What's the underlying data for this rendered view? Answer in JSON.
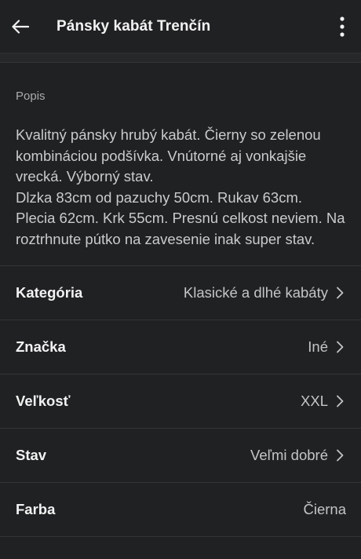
{
  "header": {
    "title": "Pánsky kabát Trenčín",
    "back_icon": "arrow-left-icon",
    "more_icon": "more-vertical-icon"
  },
  "description": {
    "label": "Popis",
    "text": "Kvalitný pánsky hrubý kabát. Čierny so zelenou kombináciou podšívka. Vnútorné aj vonkajšie vrecká. Výborný stav.\nDlzka 83cm od pazuchy 50cm. Rukav 63cm. Plecia 62cm. Krk 55cm. Presnú celkost neviem. Na roztrhnute pútko na zavesenie inak super stav."
  },
  "details": [
    {
      "label": "Kategória",
      "value": "Klasické a dlhé kabáty",
      "has_chevron": true
    },
    {
      "label": "Značka",
      "value": "Iné",
      "has_chevron": true
    },
    {
      "label": "Veľkosť",
      "value": "XXL",
      "has_chevron": true
    },
    {
      "label": "Stav",
      "value": "Veľmi dobré",
      "has_chevron": true
    },
    {
      "label": "Farba",
      "value": "Čierna",
      "has_chevron": false
    }
  ],
  "colors": {
    "background": "#1f2122",
    "text_primary": "#f2f2f2",
    "text_secondary": "#c3c5c6",
    "divider": "#333536"
  }
}
